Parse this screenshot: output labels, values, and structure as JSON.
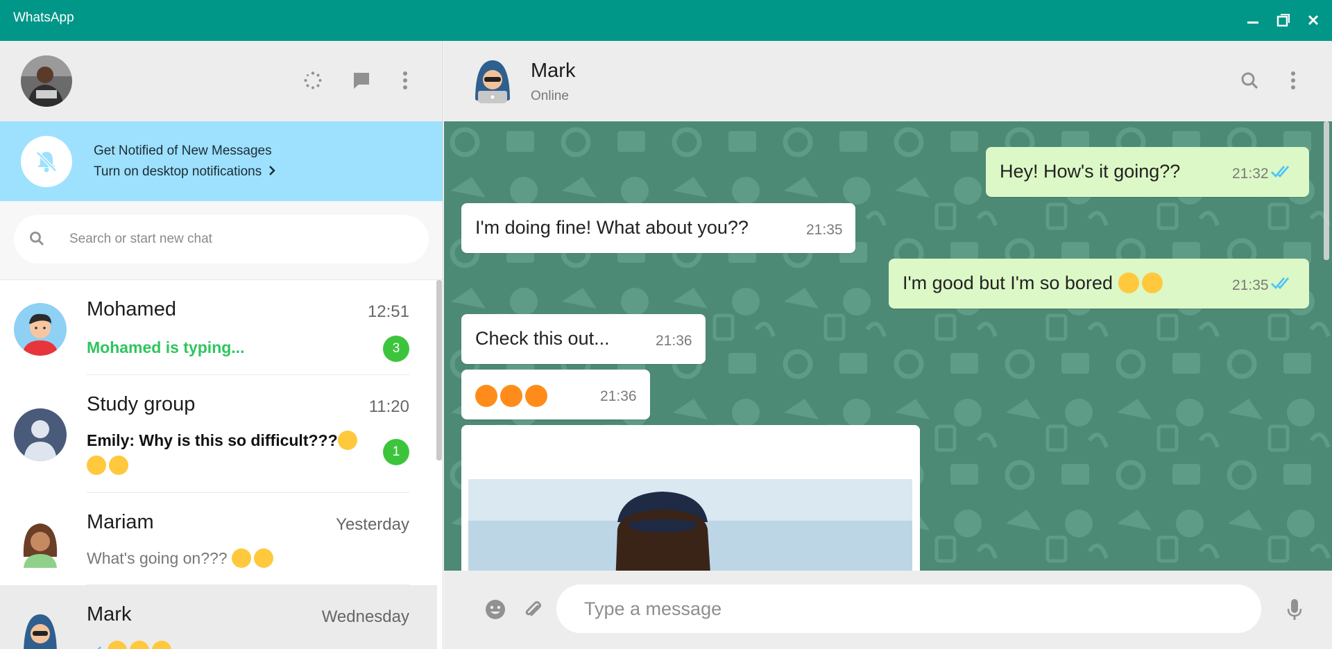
{
  "window": {
    "title": "WhatsApp",
    "accent": "#009688",
    "controls": [
      "minimize-icon",
      "maximize-icon",
      "close-icon"
    ]
  },
  "left_header": {
    "icons": [
      "status-icon",
      "new-chat-icon",
      "menu-icon"
    ]
  },
  "notification_banner": {
    "title": "Get Notified of New Messages",
    "link": "Turn on desktop notifications",
    "icon": "bell-off-icon"
  },
  "search": {
    "placeholder": "Search or start new chat",
    "value": ""
  },
  "chats": [
    {
      "name": "Mohamed",
      "time": "12:51",
      "preview": "Mohamed is typing...",
      "unread": "3",
      "typing": true
    },
    {
      "name": "Study group",
      "time": "11:20",
      "preview": "Emily: Why is this so difficult???",
      "preview_emojis": [
        "weary-emoji",
        "weary-emoji",
        "weary-emoji"
      ],
      "unread": "1"
    },
    {
      "name": "Mariam",
      "time": "Yesterday",
      "preview": "What's going on???",
      "preview_emojis": [
        "vulcan-salute-emoji",
        "vulcan-salute-emoji"
      ]
    },
    {
      "name": "Mark",
      "time": "Wednesday",
      "preview_emojis": [
        "check-icon",
        "laughing-emoji",
        "laughing-emoji",
        "laughing-emoji"
      ],
      "active": true
    }
  ],
  "conversation_header": {
    "name": "Mark",
    "status": "Online",
    "icons": [
      "search-icon",
      "menu-icon"
    ]
  },
  "messages": [
    {
      "direction": "out",
      "text": "Hey! How's it going??",
      "time": "21:32",
      "read": true
    },
    {
      "direction": "in",
      "text": "I'm doing fine! What about you??",
      "time": "21:35"
    },
    {
      "direction": "out",
      "text": "I'm good but I'm so bored",
      "emojis": [
        "kissing-emoji",
        "kissing-emoji"
      ],
      "time": "21:35",
      "read": true
    },
    {
      "direction": "in",
      "text": "Check this out...",
      "time": "21:36"
    },
    {
      "direction": "in",
      "text": "",
      "emojis": [
        "squinting-tongue-emoji",
        "squinting-tongue-emoji",
        "squinting-tongue-emoji"
      ],
      "time": "21:36"
    },
    {
      "direction": "in",
      "type": "image",
      "image": "photo-of-person"
    }
  ],
  "composer": {
    "placeholder": "Type a message",
    "value": "",
    "icons": [
      "emoji-icon",
      "attach-icon",
      "microphone-icon"
    ]
  },
  "colors": {
    "notification_bg": "#9de1fe",
    "outgoing_bubble": "#dcf8c6",
    "unread_badge": "#3cc53c",
    "typing_text": "#2ec55d",
    "read_ticks": "#4fc3f7",
    "chat_wallpaper": "#4d8a76"
  }
}
